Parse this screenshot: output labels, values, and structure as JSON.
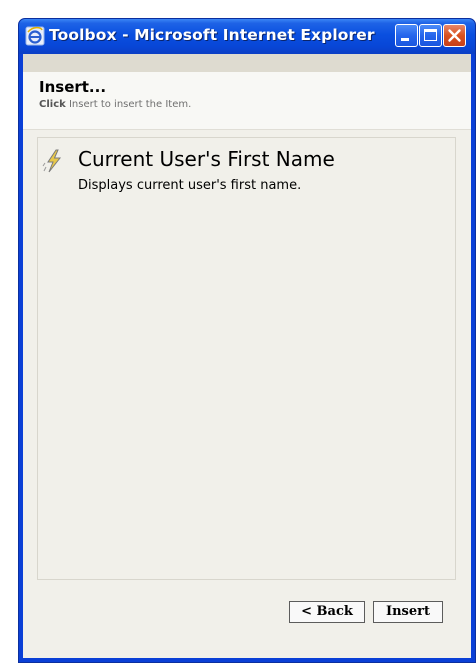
{
  "window": {
    "title": "Toolbox - Microsoft Internet Explorer",
    "buttons": {
      "minimize": "minimize",
      "maximize": "maximize",
      "close": "close"
    }
  },
  "header": {
    "title": "Insert...",
    "subtitle_bold": "Click",
    "subtitle_rest": "Insert to insert the Item."
  },
  "item": {
    "icon": "lightning-icon",
    "title": "Current User's First Name",
    "description": "Displays current user's first name."
  },
  "buttons": {
    "back": "< Back",
    "insert": "Insert"
  },
  "colors": {
    "titlebar": "#0a4fe0",
    "close": "#d9521f",
    "client": "#f1f0ea"
  }
}
